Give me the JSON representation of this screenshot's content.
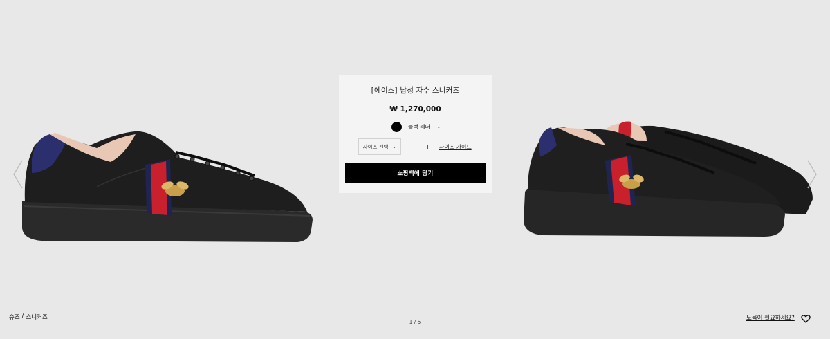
{
  "product": {
    "title": "[에이스] 남성 자수 스니커즈",
    "price": "₩ 1,270,000",
    "color": {
      "label": "블랙 레더",
      "swatch": "#000000"
    },
    "size_select": {
      "selected": "사이즈 선택"
    },
    "size_guide_label": "사이즈 가이드",
    "add_to_bag_label": "쇼핑백에 담기"
  },
  "breadcrumb": {
    "items": [
      "슈즈",
      "스니커즈"
    ],
    "separator": "/"
  },
  "pager": {
    "text": "1 / 5"
  },
  "help_label": "도움이 필요하세요?",
  "icons": {
    "prev": "chevron-left-icon",
    "next": "chevron-right-icon",
    "dropdown": "chevron-down-icon",
    "size_guide": "ruler-icon",
    "wishlist": "heart-icon"
  },
  "colors": {
    "background": "#e8e8e8",
    "card": "#f4f4f4",
    "button": "#000000",
    "stripe_red": "#c8202c",
    "stripe_navy": "#1e2550"
  }
}
